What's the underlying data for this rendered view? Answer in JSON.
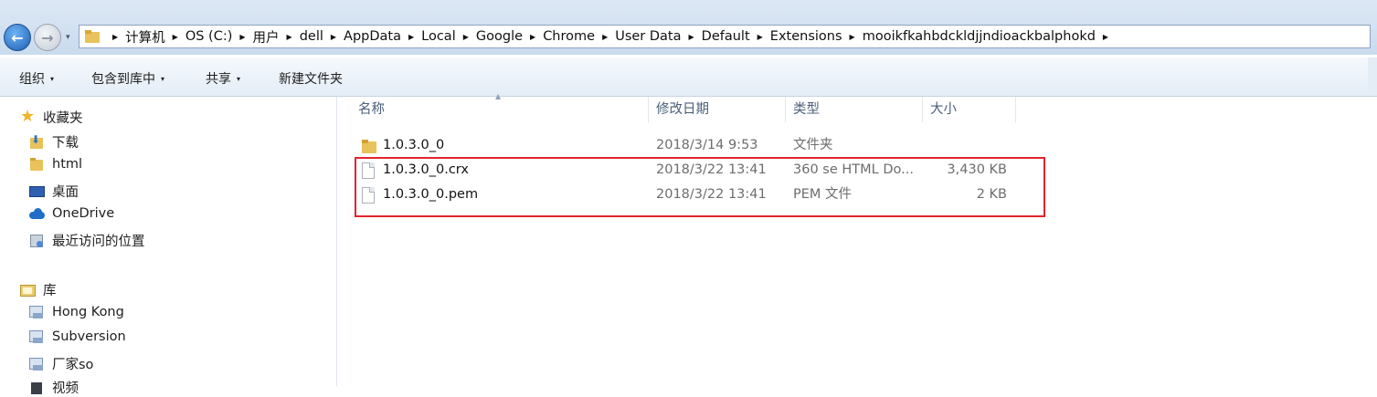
{
  "nav": {
    "back_glyph": "←",
    "forward_glyph": "→",
    "dropdown_glyph": "▾"
  },
  "address": {
    "separator": "▶",
    "crumbs": [
      "计算机",
      "OS (C:)",
      "用户",
      "dell",
      "AppData",
      "Local",
      "Google",
      "Chrome",
      "User Data",
      "Default",
      "Extensions",
      "mooikfkahbdckldjjndioackbalphokd"
    ]
  },
  "toolbar": {
    "organize": "组织",
    "include_in_library": "包含到库中",
    "share": "共享",
    "new_folder": "新建文件夹",
    "caret": "▾"
  },
  "sidebar": {
    "favorites": {
      "label": "收藏夹",
      "icon": "star-icon"
    },
    "favorites_items": [
      {
        "label": "下载",
        "icon": "downloads-folder-icon"
      },
      {
        "label": "html",
        "icon": "folder-icon"
      },
      {
        "label": "桌面",
        "icon": "desktop-icon"
      },
      {
        "label": "OneDrive",
        "icon": "onedrive-cloud-icon"
      },
      {
        "label": "最近访问的位置",
        "icon": "recent-places-icon"
      }
    ],
    "libraries": {
      "label": "库",
      "icon": "library-icon"
    },
    "library_items": [
      {
        "label": "Hong Kong",
        "icon": "library-item-icon"
      },
      {
        "label": "Subversion",
        "icon": "library-item-icon"
      },
      {
        "label": "厂家so",
        "icon": "library-item-icon"
      },
      {
        "label": "视频",
        "icon": "video-library-icon"
      }
    ]
  },
  "columns": {
    "name": "名称",
    "modified": "修改日期",
    "type": "类型",
    "size": "大小",
    "sort_glyph": "▲"
  },
  "files": [
    {
      "name": "1.0.3.0_0",
      "modified": "2018/3/14 9:53",
      "type": "文件夹",
      "size": "",
      "icon": "folder-icon"
    },
    {
      "name": "1.0.3.0_0.crx",
      "modified": "2018/3/22 13:41",
      "type": "360 se HTML Do...",
      "size": "3,430 KB",
      "icon": "file-icon"
    },
    {
      "name": "1.0.3.0_0.pem",
      "modified": "2018/3/22 13:41",
      "type": "PEM 文件",
      "size": "2 KB",
      "icon": "file-icon"
    }
  ],
  "colors": {
    "highlight_border": "#e3232c",
    "toolbar_bg": "#e4ecf6",
    "nav_bg": "#c9dbee"
  }
}
